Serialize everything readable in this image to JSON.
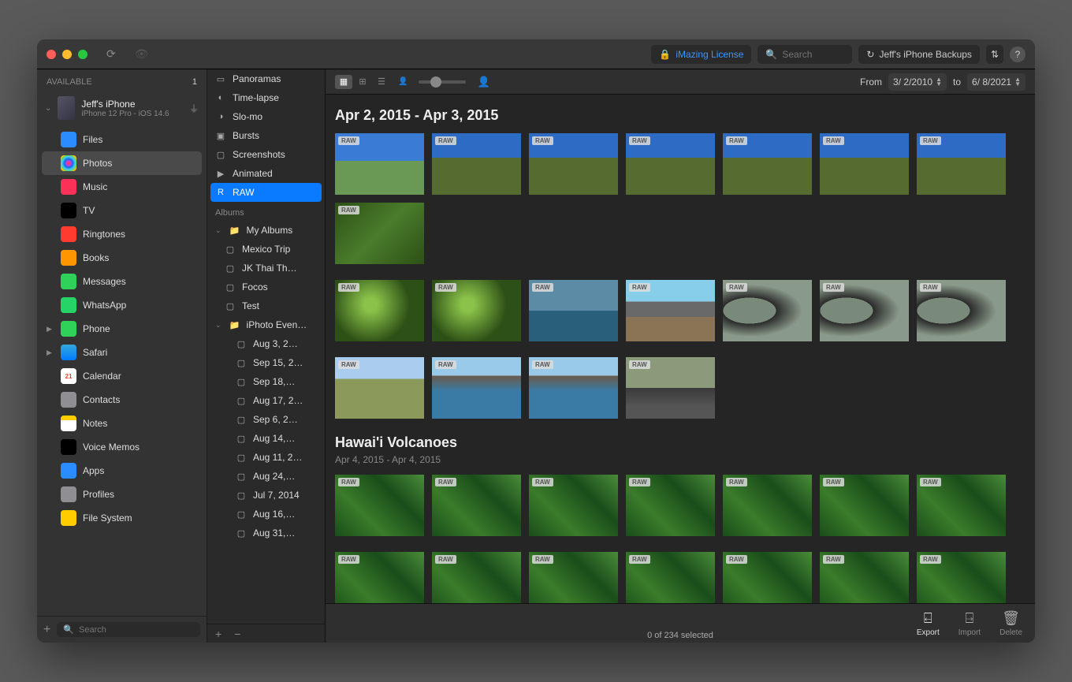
{
  "titlebar": {
    "license_label": "iMazing License",
    "search_placeholder": "Search",
    "backups_label": "Jeff's iPhone Backups"
  },
  "sidebar1": {
    "header": "AVAILABLE",
    "count": "1",
    "device": {
      "name": "Jeff's iPhone",
      "sub": "iPhone 12 Pro - iOS 14.6"
    },
    "items": [
      {
        "label": "Files",
        "icon": "ic-files"
      },
      {
        "label": "Photos",
        "icon": "ic-photos",
        "selected": true
      },
      {
        "label": "Music",
        "icon": "ic-music"
      },
      {
        "label": "TV",
        "icon": "ic-tv"
      },
      {
        "label": "Ringtones",
        "icon": "ic-ring"
      },
      {
        "label": "Books",
        "icon": "ic-books"
      },
      {
        "label": "Messages",
        "icon": "ic-msg"
      },
      {
        "label": "WhatsApp",
        "icon": "ic-wa"
      },
      {
        "label": "Phone",
        "icon": "ic-phone",
        "chev": true
      },
      {
        "label": "Safari",
        "icon": "ic-safari",
        "chev": true
      },
      {
        "label": "Calendar",
        "icon": "ic-cal"
      },
      {
        "label": "Contacts",
        "icon": "ic-contacts"
      },
      {
        "label": "Notes",
        "icon": "ic-notes"
      },
      {
        "label": "Voice Memos",
        "icon": "ic-voice"
      },
      {
        "label": "Apps",
        "icon": "ic-apps"
      },
      {
        "label": "Profiles",
        "icon": "ic-profiles"
      },
      {
        "label": "File System",
        "icon": "ic-fs"
      }
    ],
    "search_placeholder": "Search"
  },
  "sidebar2": {
    "media_types": [
      "Panoramas",
      "Time-lapse",
      "Slo-mo",
      "Bursts",
      "Screenshots",
      "Animated",
      "RAW"
    ],
    "selected": "RAW",
    "albums_header": "Albums",
    "my_albums_label": "My Albums",
    "my_albums": [
      "Mexico Trip",
      "JK Thai Th…",
      "Focos",
      "Test"
    ],
    "iphoto_label": "iPhoto Even…",
    "iphoto_events": [
      "Aug 3, 2…",
      "Sep 15, 2…",
      "Sep 18,…",
      "Aug 17, 2…",
      "Sep 6, 2…",
      "Aug 14,…",
      "Aug 11, 2…",
      "Aug 24,…",
      "Jul 7, 2014",
      "Aug 16,…",
      "Aug 31,…"
    ]
  },
  "toolbar": {
    "from_label": "From",
    "from_date": "3/  2/2010",
    "to_label": "to",
    "to_date": "6/  8/2021"
  },
  "groups": [
    {
      "title": "Apr 2, 2015 - Apr 3, 2015",
      "sub": "",
      "rows": [
        [
          "sky",
          "sky2",
          "sky2",
          "sky2",
          "sky2",
          "sky2",
          "sky2",
          "green"
        ],
        [
          "leaf",
          "leaf",
          "ocean",
          "road",
          "mirror",
          "mirror",
          "mirror"
        ],
        [
          "land",
          "sea",
          "sea",
          "beach"
        ]
      ]
    },
    {
      "title": "Hawai'i Volcanoes",
      "sub": "Apr 4, 2015 - Apr 4, 2015",
      "rows": [
        [
          "jungle",
          "jungle",
          "jungle",
          "jungle",
          "jungle",
          "jungle",
          "jungle"
        ],
        [
          "jungle",
          "jungle",
          "jungle",
          "jungle",
          "jungle",
          "jungle",
          "jungle"
        ]
      ]
    }
  ],
  "raw_badge": "RAW",
  "cal_day": "21",
  "footer": {
    "export": "Export",
    "import": "Import",
    "delete": "Delete",
    "status": "0 of 234 selected"
  }
}
